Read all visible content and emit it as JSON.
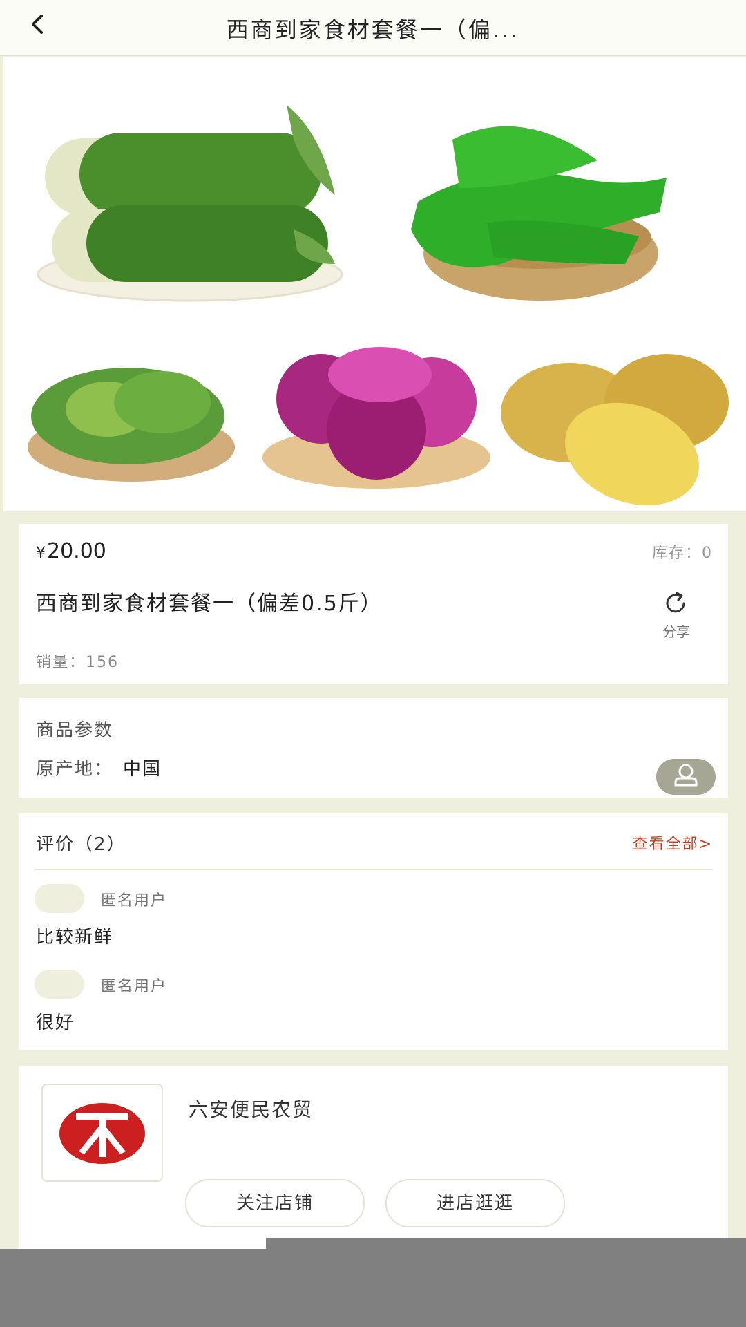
{
  "header": {
    "back_icon": "back-arrow-icon",
    "title": "西商到家食材套餐一（偏..."
  },
  "hero": {
    "images": [
      "wax-gourd-image",
      "green-pepper-image",
      "cabbage-image",
      "onion-image",
      "potato-image"
    ]
  },
  "product": {
    "currency": "¥",
    "price": "20.00",
    "stock": "库存：0",
    "name": "西商到家食材套餐一（偏差0.5斤）",
    "share_icon": "share-icon",
    "share_label": "分享",
    "sales": "销量：156"
  },
  "params": {
    "title": "商品参数",
    "origin_label": "原产地：",
    "origin_value": "中国"
  },
  "reviews": {
    "title": "评价（2）",
    "view_all": "查看全部>",
    "items": [
      {
        "user": "匿名用户",
        "content": "比较新鲜"
      },
      {
        "user": "匿名用户",
        "content": "很好"
      }
    ]
  },
  "store": {
    "name": "六安便民农贸",
    "follow_label": "关注店铺",
    "enter_label": "进店逛逛"
  },
  "colors": {
    "background": "#eef0dd",
    "accent_red": "#c0442a",
    "logo_red": "#cc1f1f"
  }
}
